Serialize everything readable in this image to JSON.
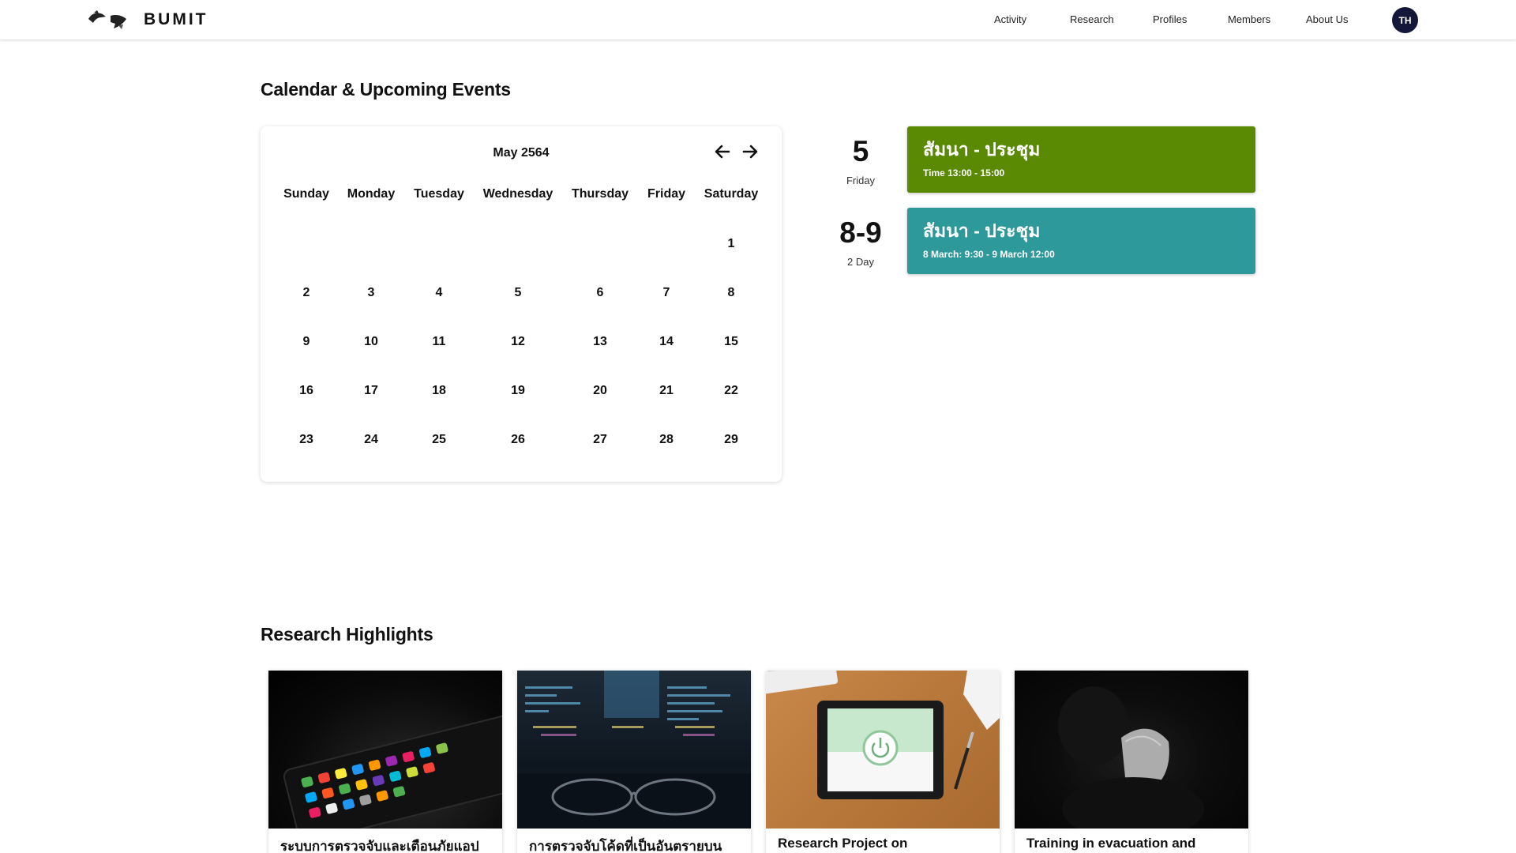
{
  "nav": {
    "logo_text": "BUMIT",
    "items": [
      "Activity",
      "Research",
      "Profiles",
      "Members",
      "About Us"
    ],
    "avatar_label": "TH"
  },
  "calendar_section": {
    "title": "Calendar & Upcoming Events",
    "month_label": "May 2564",
    "weekdays": [
      "Sunday",
      "Monday",
      "Tuesday",
      "Wednesday",
      "Thursday",
      "Friday",
      "Saturday"
    ],
    "weeks": [
      [
        "",
        "",
        "",
        "",
        "",
        "",
        "1"
      ],
      [
        "2",
        "3",
        "4",
        "5",
        "6",
        "7",
        "8"
      ],
      [
        "9",
        "10",
        "11",
        "12",
        "13",
        "14",
        "15"
      ],
      [
        "16",
        "17",
        "18",
        "19",
        "20",
        "21",
        "22"
      ],
      [
        "23",
        "24",
        "25",
        "26",
        "27",
        "28",
        "29"
      ]
    ]
  },
  "events": [
    {
      "date": "5",
      "sub": "Friday",
      "title": "สัมนา - ประชุม",
      "time": "Time 13:00 - 15:00",
      "color": "#5a8a04"
    },
    {
      "date": "8-9",
      "sub": "2 Day",
      "title": "สัมนา - ประชุม",
      "time": "8 March: 9:30 - 9 March 12:00",
      "color": "#2e999b"
    }
  ],
  "research_section": {
    "title": "Research Highlights",
    "cards": [
      {
        "title": "ระบบการตรวจจับและเตือนภัยแอป",
        "image": "smartphone-apps-photo"
      },
      {
        "title": "การตรวจจับโค้ดที่เป็นอันตรายบน",
        "image": "code-screen-glasses-photo"
      },
      {
        "title": "Research Project on",
        "image": "tablet-power-desk-photo"
      },
      {
        "title": "Training in evacuation and",
        "image": "dark-person-photo"
      }
    ]
  }
}
